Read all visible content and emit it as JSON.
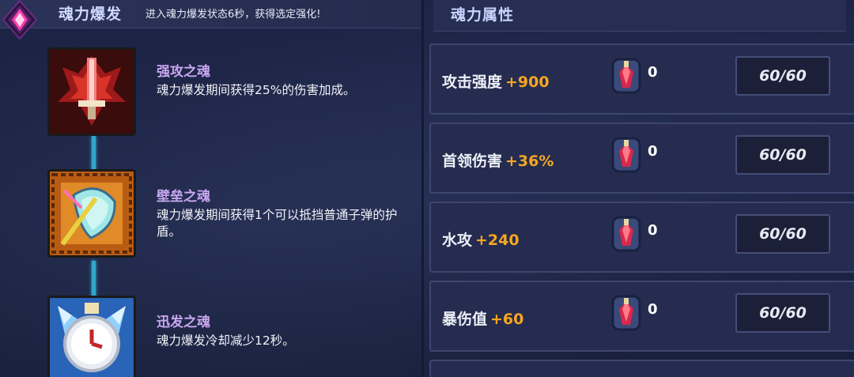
{
  "left_panel": {
    "title": "魂力爆发",
    "subtitle": "进入魂力爆发状态6秒，获得选定强化!",
    "skills": [
      {
        "name": "强攻之魂",
        "description": "魂力爆发期间获得25%的伤害加成。",
        "icon": "red-sword-soul-icon"
      },
      {
        "name": "壁垒之魂",
        "description": "魂力爆发期间获得1个可以抵挡普通子弹的护盾。",
        "icon": "shield-soul-icon"
      },
      {
        "name": "迅发之魂",
        "description": "魂力爆发冷却减少12秒。",
        "icon": "clock-soul-icon"
      }
    ]
  },
  "right_panel": {
    "title": "魂力属性",
    "attributes": [
      {
        "label": "攻击强度",
        "bonus": "+900",
        "gem_count": "0",
        "level": "60/60"
      },
      {
        "label": "首领伤害",
        "bonus": "+36%",
        "gem_count": "0",
        "level": "60/60"
      },
      {
        "label": "水攻",
        "bonus": "+240",
        "gem_count": "0",
        "level": "60/60"
      },
      {
        "label": "暴伤值",
        "bonus": "+60",
        "gem_count": "0",
        "level": "60/60"
      }
    ]
  },
  "colors": {
    "accent_orange": "#f5a623",
    "skill_name_purple": "#c9a6f0",
    "chain_cyan": "#2fa8c8"
  }
}
